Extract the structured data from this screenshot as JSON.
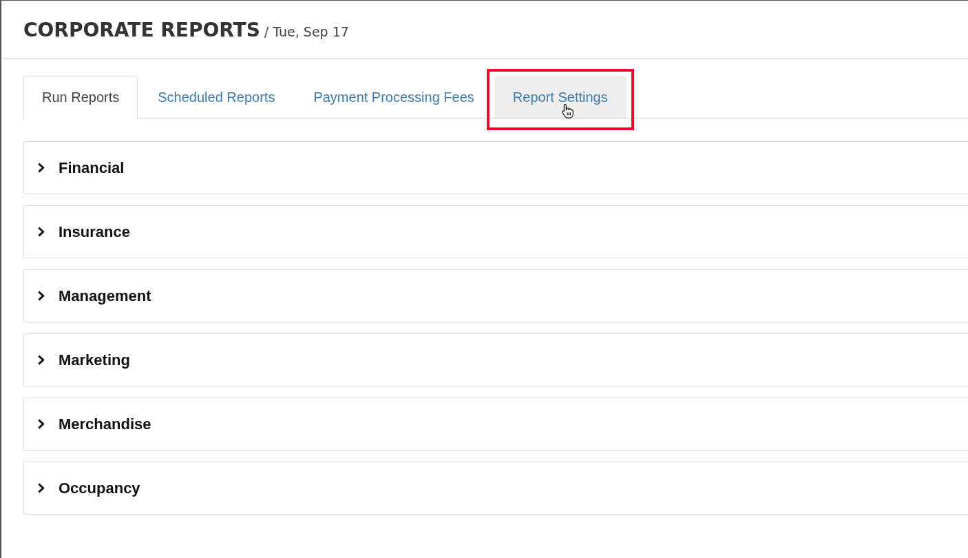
{
  "header": {
    "title": "CORPORATE REPORTS",
    "date": "/ Tue, Sep 17"
  },
  "tabs": [
    {
      "label": "Run Reports",
      "selected": true,
      "hovered": false,
      "highlighted": false
    },
    {
      "label": "Scheduled Reports",
      "selected": false,
      "hovered": false,
      "highlighted": false
    },
    {
      "label": "Payment Processing Fees",
      "selected": false,
      "hovered": false,
      "highlighted": false
    },
    {
      "label": "Report Settings",
      "selected": false,
      "hovered": true,
      "highlighted": true
    }
  ],
  "sections": [
    {
      "label": "Financial",
      "expanded": false
    },
    {
      "label": "Insurance",
      "expanded": false
    },
    {
      "label": "Management",
      "expanded": false
    },
    {
      "label": "Marketing",
      "expanded": false
    },
    {
      "label": "Merchandise",
      "expanded": false
    },
    {
      "label": "Occupancy",
      "expanded": false
    }
  ]
}
